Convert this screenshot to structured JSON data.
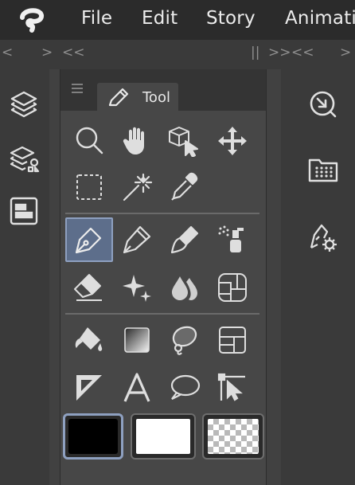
{
  "menubar": {
    "logo_icon": "clip-studio-logo-icon",
    "items": [
      "File",
      "Edit",
      "Story",
      "Animatio"
    ]
  },
  "navbar": {
    "glyphs": [
      "<",
      ">",
      "<<",
      "||",
      ">>",
      "<<",
      ">"
    ]
  },
  "left_dock": [
    "layers-icon",
    "layer-property-icon",
    "navigator-icon"
  ],
  "right_dock": [
    "search-history-icon",
    "material-folder-icon",
    "sub-tool-settings-icon"
  ],
  "panel": {
    "menu_icon": "hamburger-icon",
    "tab_icon": "pen-tool-icon",
    "tab_label": "Tool"
  },
  "tools": [
    "zoom-icon",
    "hand-icon",
    "object-icon",
    "move-icon",
    "selection-icon",
    "auto-select-icon",
    "eyedropper-icon",
    "pen-icon",
    "pencil-icon",
    "brush-icon",
    "airbrush-icon",
    "eraser-icon",
    "decoration-icon",
    "blend-icon",
    "figure-icon",
    "fill-icon",
    "gradient-icon",
    "lasso-fill-icon",
    "frame-border-icon",
    "ruler-icon",
    "text-icon",
    "balloon-icon",
    "correct-line-icon"
  ],
  "selected_tool": "pen-icon",
  "colors": {
    "main": "#000000",
    "sub": "#ffffff",
    "transparent": "checkerboard",
    "selected_outline": "#8ea0c0",
    "selected_bg": "#5d6e8b"
  }
}
